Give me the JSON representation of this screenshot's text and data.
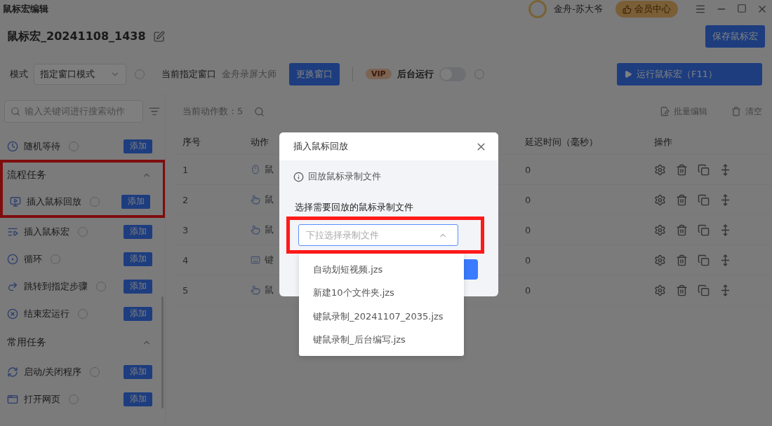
{
  "window": {
    "title": "鼠标宏编辑"
  },
  "account": {
    "username": "金舟-苏大爷",
    "member_button": "会员中心"
  },
  "macro": {
    "name": "鼠标宏_20241108_1438",
    "save_button": "保存鼠标宏"
  },
  "toolbar": {
    "mode_label": "模式",
    "mode_value": "指定窗口模式",
    "window_label": "当前指定窗口",
    "window_value": "金舟录屏大师",
    "change_button": "更换窗口",
    "vip_badge": "VIP",
    "background_label": "后台运行",
    "background_on": false,
    "run_button": "运行鼠标宏（F11）"
  },
  "sidebar": {
    "search_placeholder": "输入关键词进行搜索动作",
    "groups": [
      {
        "items": [
          {
            "label": "随机等待",
            "kind": "clock",
            "add_button": "添加"
          }
        ]
      },
      {
        "title": "流程任务",
        "expanded": true,
        "highlighted": true,
        "items": [
          {
            "label": "插入鼠标回放",
            "kind": "playback",
            "add_button": "添加",
            "highlighted": true
          },
          {
            "label": "插入鼠标宏",
            "kind": "list",
            "add_button": "添加"
          },
          {
            "label": "循环",
            "kind": "loop",
            "add_button": "添加"
          },
          {
            "label": "跳转到指定步骤",
            "kind": "jump",
            "add_button": "添加"
          },
          {
            "label": "结束宏运行",
            "kind": "stop",
            "add_button": "添加"
          }
        ]
      },
      {
        "title": "常用任务",
        "expanded": true,
        "highlighted": false,
        "items": [
          {
            "label": "启动/关闭程序",
            "kind": "program",
            "add_button": "添加"
          },
          {
            "label": "打开网页",
            "kind": "web",
            "add_button": "添加"
          }
        ]
      }
    ]
  },
  "main": {
    "count": "当前动作数：5",
    "batch_edit": "批量编辑",
    "clear": "清空",
    "columns": [
      "序号",
      "动作",
      "延迟时间（毫秒）",
      "操作"
    ],
    "rows": [
      {
        "index": "1",
        "kind": "mouse",
        "action": "鼠",
        "delay": "0"
      },
      {
        "index": "2",
        "kind": "click",
        "action": "鼠",
        "delay": "0"
      },
      {
        "index": "3",
        "kind": "click",
        "action": "鼠",
        "delay": "0"
      },
      {
        "index": "4",
        "kind": "keyboard",
        "action": "键",
        "delay": "0"
      },
      {
        "index": "5",
        "kind": "click",
        "action": "鼠",
        "delay": "0"
      }
    ]
  },
  "dialog": {
    "title": "插入鼠标回放",
    "info": "回放鼠标录制文件",
    "field_label": "选择需要回放的鼠标录制文件",
    "placeholder": "下拉选择录制文件",
    "highlighted": true,
    "expanded": true,
    "options": [
      "自动划短视频.jzs",
      "新建10个文件夹.jzs",
      "键鼠录制_20241107_2035.jzs",
      "键鼠录制_后台编写.jzs"
    ]
  }
}
